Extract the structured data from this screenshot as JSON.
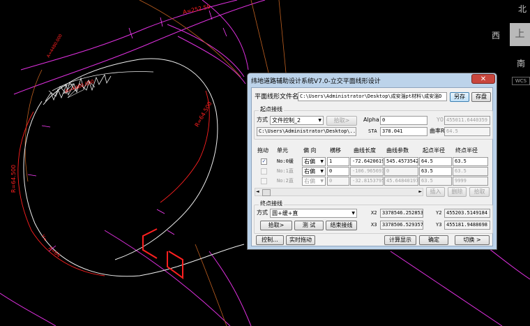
{
  "compass": {
    "north": "北",
    "west": "西",
    "south": "南",
    "cube_face": "上",
    "wcs": "WCS"
  },
  "cad_labels": [
    {
      "text": "A=252.59",
      "color": "#ff2020"
    },
    {
      "text": "R=64.500",
      "color": "#ff2020"
    },
    {
      "text": "R=64.500",
      "color": "#ff2020"
    },
    {
      "text": "A=4480.000",
      "color": "#ff2020"
    },
    {
      "text": "A=4480.000",
      "color": "#ff2020"
    },
    {
      "text": "Y=",
      "color": "#ff2020"
    },
    {
      "text": "A=64",
      "color": "#ff2020"
    }
  ],
  "dialog": {
    "title": "纬地道路辅助设计系统V7.0-立交平面线形设计",
    "close": "✕",
    "file_label": "平面线形文件名",
    "file_path": "C:\\Users\\Administrator\\Desktop\\成安淄pt材料\\成安淄D",
    "save_as": "另存",
    "save": "存盘",
    "start": {
      "group": "起点接线",
      "method_label": "方式",
      "method_value": "文件控制_2",
      "pick": "拾取>",
      "alpha_label": "Alpha",
      "alpha_value": "0",
      "y0_label": "Y0",
      "y0_value": "455011.6440359",
      "path_value": "C:\\Users\\Administrator\\Desktop\\...",
      "sta_label": "STA",
      "sta_value": "378.041",
      "curv_label": "曲率R",
      "curv_value": "64.5"
    },
    "table": {
      "headers": [
        "拖动",
        "单元",
        "偏 向",
        "横移",
        "曲线长度",
        "曲线参数",
        "起点半径",
        "终点半径"
      ],
      "rows": [
        {
          "checked": true,
          "unit": "No:0缓",
          "dir": "右偏",
          "shift": "1",
          "length": "-72.6420619",
          "param": "545.4573542",
          "r_start": "64.5",
          "r_end": "63.5"
        },
        {
          "checked": false,
          "unit": "No:1直",
          "dir": "右偏",
          "shift": "0",
          "length": "-106.965693",
          "param": "0",
          "r_start": "63.5",
          "r_end": "63.5"
        },
        {
          "checked": false,
          "unit": "No:2直",
          "dir": "右偏",
          "shift": "0",
          "length": "-32.8153795",
          "param": "45.64840197",
          "r_start": "63.5",
          "r_end": "9999"
        }
      ],
      "insert": "插入",
      "delete": "删除",
      "pick": "拾取"
    },
    "end": {
      "group": "终点接线",
      "method_label": "方式",
      "method_value": "圆+缓+直",
      "x2_label": "X2",
      "x2_value": "3378546.252853",
      "y2_label": "Y2",
      "y2_value": "455203.5149184",
      "x3_label": "X3",
      "x3_value": "3378506.529357",
      "y3_label": "Y3",
      "y3_value": "455181.9488698",
      "pick": "拾取>",
      "test": "测 试",
      "end_line": "结束接线"
    },
    "bottom": {
      "control": "控制...",
      "realtime": "实时拖动",
      "calc": "计算显示",
      "ok": "确定",
      "switch": "切换 >"
    }
  }
}
